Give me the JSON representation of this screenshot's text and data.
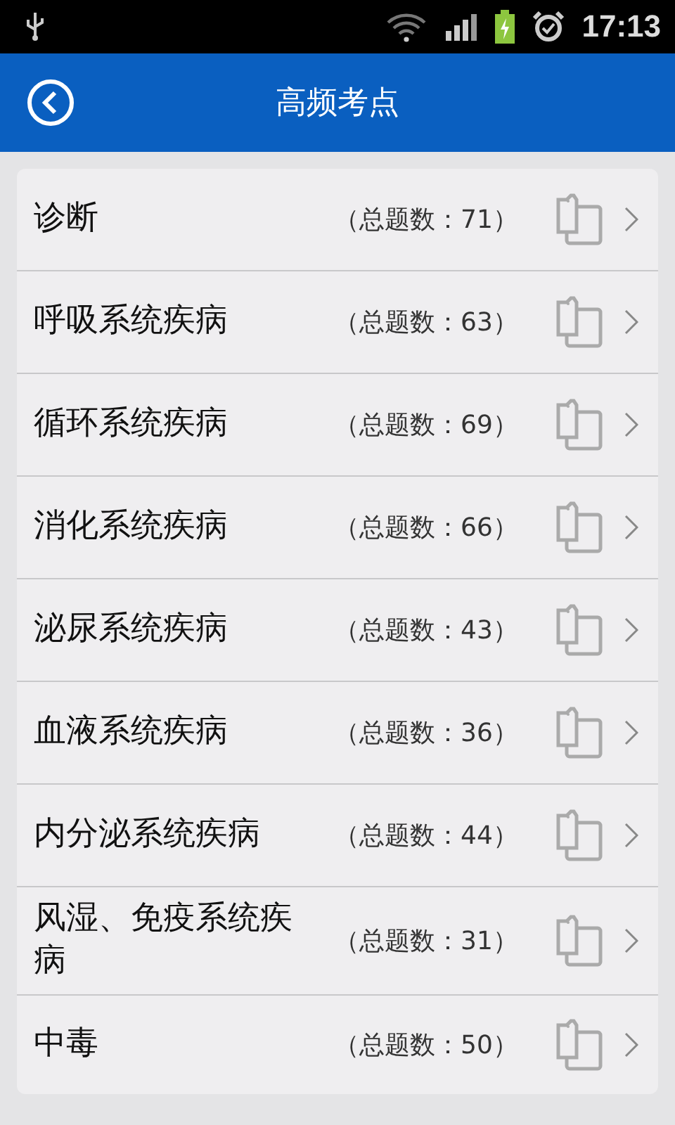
{
  "status_bar": {
    "time": "17:13"
  },
  "header": {
    "title": "高频考点"
  },
  "items": [
    {
      "name": "诊断",
      "count": "（总题数：71）"
    },
    {
      "name": "呼吸系统疾病",
      "count": "（总题数：63）"
    },
    {
      "name": "循环系统疾病",
      "count": "（总题数：69）"
    },
    {
      "name": "消化系统疾病",
      "count": "（总题数：66）"
    },
    {
      "name": "泌尿系统疾病",
      "count": "（总题数：43）"
    },
    {
      "name": "血液系统疾病",
      "count": "（总题数：36）"
    },
    {
      "name": "内分泌系统疾病",
      "count": "（总题数：44）"
    },
    {
      "name": "风湿、免疫系统疾病",
      "count": "（总题数：31）"
    },
    {
      "name": "中毒",
      "count": "（总题数：50）"
    }
  ]
}
